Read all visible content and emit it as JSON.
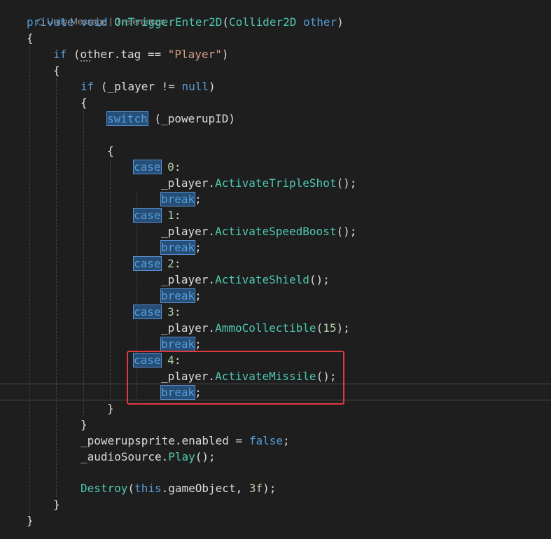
{
  "codelens": {
    "icon": "cube-icon",
    "text": "Unity Message | 0 references"
  },
  "code": {
    "l1_private": "private",
    "l1_void": "void",
    "l1_method": "OnTriggerEnter2D",
    "l1_paren_open": "(",
    "l1_type": "Collider2D",
    "l1_param": "other",
    "l1_paren_close": ")",
    "brace_open": "{",
    "brace_close": "}",
    "if": "if",
    "l3_cond_start": " (other.tag == ",
    "l3_string": "\"Player\"",
    "l3_cond_end": ")",
    "l5_cond": " (_player != ",
    "null": "null",
    "close_paren": ")",
    "switch": "switch",
    "switch_expr": " (_powerupID)",
    "case": "case",
    "break": "break",
    "semicolon": ";",
    "case_0": "0",
    "case_1": "1",
    "case_2": "2",
    "case_3": "3",
    "case_4": "4",
    "colon": ":",
    "player_prefix": "_player.",
    "m0": "ActivateTripleShot",
    "m1": "ActivateSpeedBoost",
    "m2": "ActivateShield",
    "m3": "AmmoCollectible",
    "m4": "ActivateMissile",
    "call_empty": "();",
    "call_15_open": "(",
    "arg_15": "15",
    "call_15_close": ");",
    "sprite_stmt": "_powerupsprite.enabled = ",
    "false": "false",
    "audio_prefix": "_audioSource.",
    "audio_method": "Play",
    "destroy": "Destroy",
    "this": "this",
    "destroy_mid": ".gameObject, ",
    "arg_3f": "3f",
    "destroy_end": ");"
  }
}
